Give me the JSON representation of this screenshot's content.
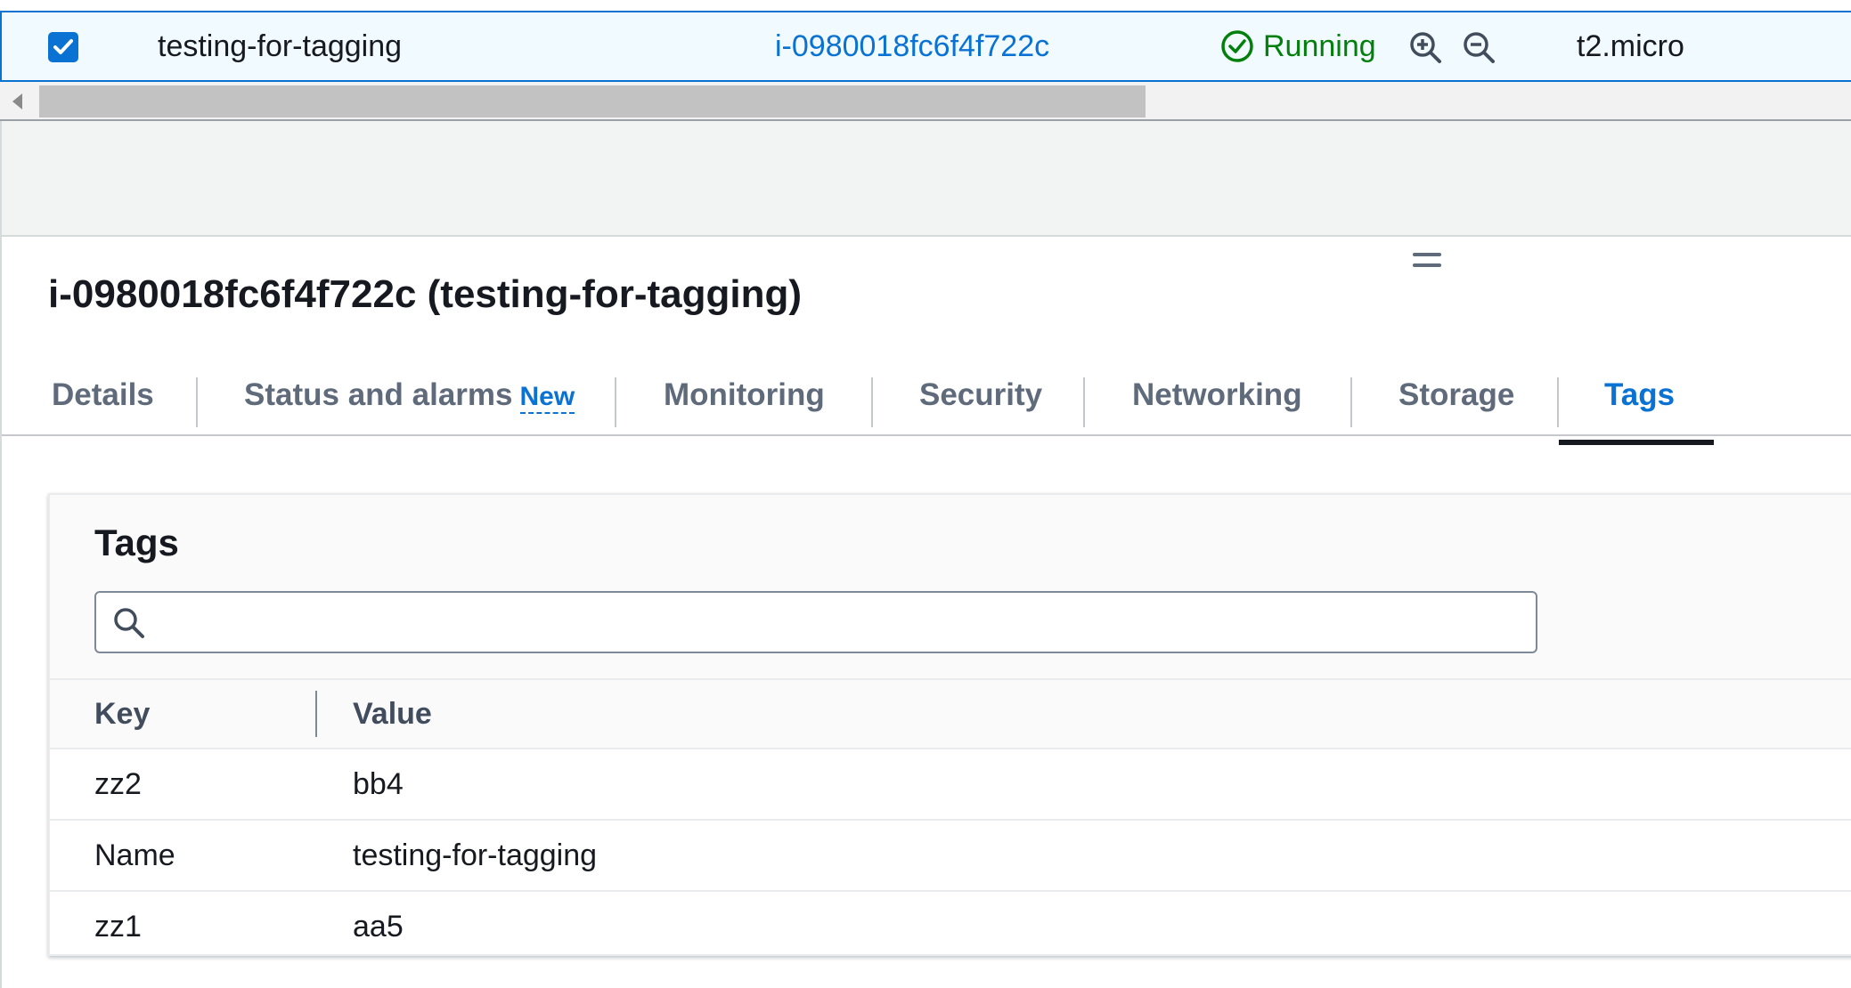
{
  "instance_row": {
    "checked": true,
    "name": "testing-for-tagging",
    "instance_id": "i-0980018fc6f4f722c",
    "state": "Running",
    "instance_type": "t2.micro"
  },
  "panel": {
    "title": "i-0980018fc6f4f722c (testing-for-tagging)",
    "tabs": [
      {
        "label": "Details"
      },
      {
        "label": "Status and alarms",
        "badge": "New"
      },
      {
        "label": "Monitoring"
      },
      {
        "label": "Security"
      },
      {
        "label": "Networking"
      },
      {
        "label": "Storage"
      },
      {
        "label": "Tags",
        "active": true
      }
    ]
  },
  "tags": {
    "title": "Tags",
    "search": {
      "value": "",
      "placeholder": ""
    },
    "columns": [
      "Key",
      "Value"
    ],
    "rows": [
      {
        "key": "zz2",
        "value": "bb4"
      },
      {
        "key": "Name",
        "value": "testing-for-tagging"
      },
      {
        "key": "zz1",
        "value": "aa5"
      }
    ]
  },
  "colors": {
    "link_blue": "#0972d3",
    "status_green": "#037f0c",
    "selected_row_bg": "#f1faff",
    "tab_inactive": "#5f6b7a"
  },
  "icons": {
    "checkbox": "checkbox-checked-icon",
    "state": "status-success-icon",
    "zoom_in": "zoom-in-icon",
    "zoom_out": "zoom-out-icon",
    "search": "search-icon",
    "resize": "drag-handle-icon"
  }
}
